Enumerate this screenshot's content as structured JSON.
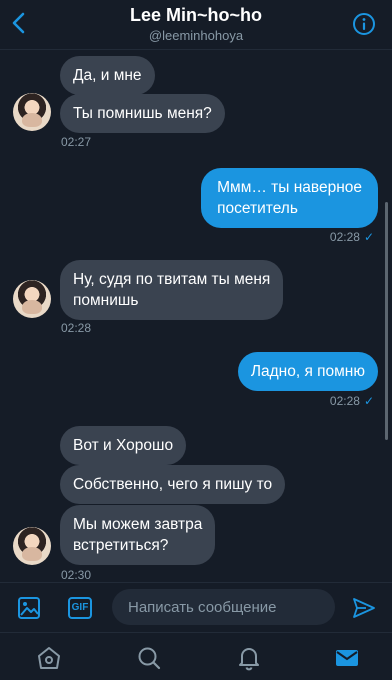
{
  "header": {
    "title": "Lee Min~ho~ho",
    "handle": "@leeminhohoya"
  },
  "messages": [
    {
      "direction": "in",
      "text": "Да, и мне"
    },
    {
      "direction": "in",
      "text": "Ты помнишь меня?",
      "time": "02:27"
    },
    {
      "direction": "out",
      "lines": [
        "Ммм… ты наверное",
        "посетитель"
      ],
      "time": "02:28"
    },
    {
      "direction": "in",
      "lines": [
        "Ну, судя по твитам ты меня",
        "помнишь"
      ],
      "time": "02:28"
    },
    {
      "direction": "out",
      "text": "Ладно, я помню",
      "time": "02:28"
    },
    {
      "direction": "in",
      "text": "Вот и Хорошо"
    },
    {
      "direction": "in",
      "text": "Собственно, чего я пишу то"
    },
    {
      "direction": "in",
      "lines": [
        "Мы можем завтра",
        "встретиться?"
      ],
      "time": "02:30"
    }
  ],
  "composer": {
    "gif_label": "GIF",
    "placeholder": "Написать сообщение"
  },
  "colors": {
    "background": "#151c27",
    "incoming_bubble": "#3a4350",
    "outgoing_bubble": "#1b95e0",
    "accent": "#1b95e0",
    "muted_text": "#8899a6"
  },
  "icons": {
    "back": "chevron-left-icon",
    "info": "info-icon",
    "media": "image-icon",
    "gif": "gif-icon",
    "send": "send-icon",
    "home": "home-icon",
    "search": "search-icon",
    "notifications": "bell-icon",
    "messages": "mail-icon"
  }
}
